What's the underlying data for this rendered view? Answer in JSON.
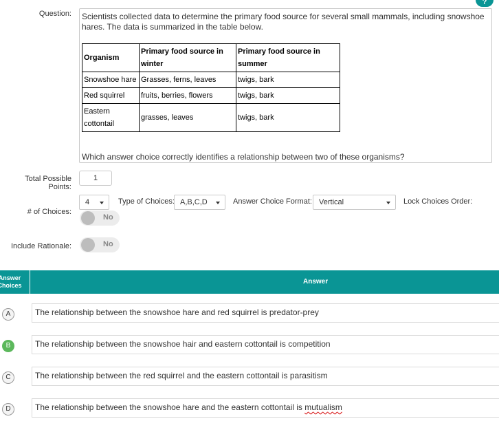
{
  "question": {
    "label": "Question:",
    "text": "Scientists collected data to determine the primary food source for several small mammals, including snowshoe hares.  The data is summarized in the table below.",
    "prompt": "Which answer choice correctly identifies a relationship between two of these organisms?",
    "table": {
      "headers": [
        "Organism",
        "Primary food source in winter",
        "Primary food source in summer"
      ],
      "rows": [
        [
          "Snowshoe hare",
          "Grasses, ferns, leaves",
          "twigs, bark"
        ],
        [
          "Red squirrel",
          "fruits, berries, flowers",
          "twigs, bark"
        ],
        [
          "Eastern cottontail",
          "grasses, leaves",
          "twigs, bark"
        ]
      ]
    }
  },
  "points": {
    "label": "Total Possible Points:",
    "value": "1"
  },
  "choices": {
    "label": "# of Choices:",
    "count": "4",
    "type_label": "Type of Choices:",
    "type_value": "A,B,C,D",
    "format_label": "Answer Choice Format:",
    "format_value": "Vertical",
    "lock_label": "Lock Choices Order:",
    "lock_value": "No"
  },
  "rationale": {
    "label": "Include Rationale:",
    "value": "No"
  },
  "answers_header": {
    "left": "Answer Choices",
    "right": "Answer"
  },
  "answers": [
    {
      "letter": "A",
      "text": "The relationship between the snowshoe hare and red squirrel is predator-prey",
      "correct": false
    },
    {
      "letter": "B",
      "text": "The relationship between the snowshoe hair and eastern cottontail is competition",
      "correct": true
    },
    {
      "letter": "C",
      "text": "The relationship between the red squirrel and the eastern cottontail is parasitism",
      "correct": false
    },
    {
      "letter": "D",
      "text_before": "The relationship between the snowshoe hare and the eastern cottontail is ",
      "text_spell": "mutualism",
      "correct": false
    }
  ],
  "colors": {
    "accent": "#0a9595",
    "correct": "#5cb85c"
  }
}
